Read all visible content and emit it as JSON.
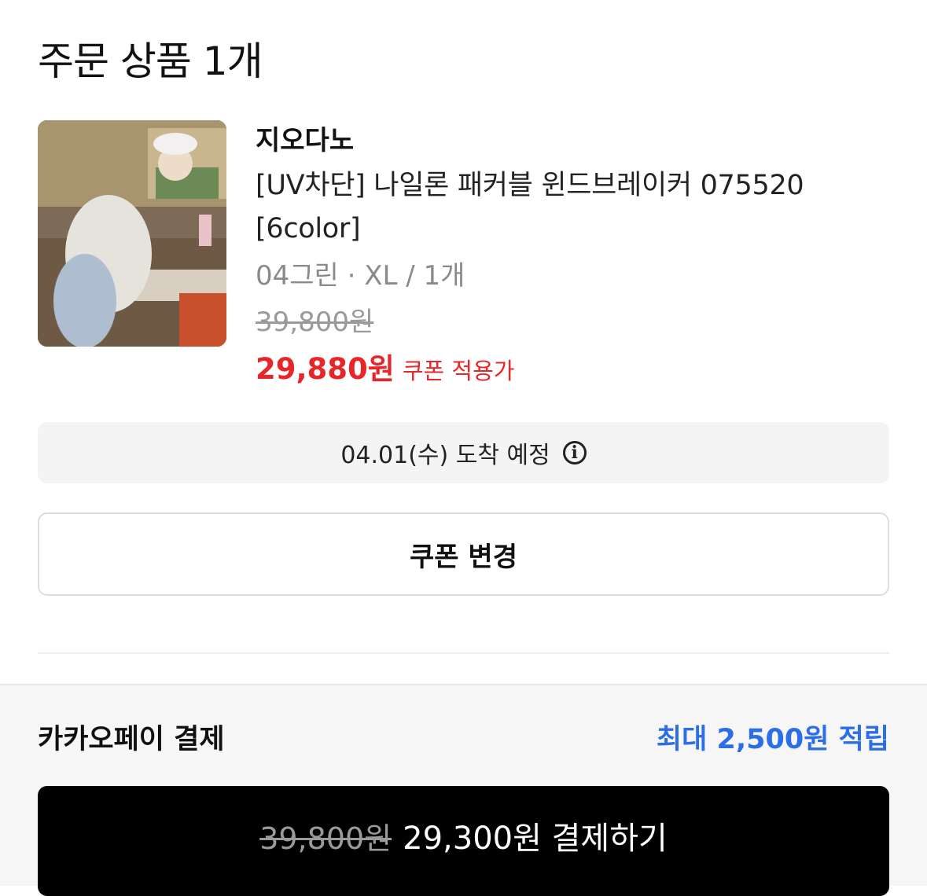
{
  "order": {
    "title": "주문 상품 1개"
  },
  "product": {
    "image_alt": "product photo",
    "brand": "지오다노",
    "name_line1": "[UV차단] 나일론 패커블 윈드브레이커 075520",
    "name_line2": "[6color]",
    "option": "04그린 · XL / 1개",
    "original_price": "39,800원",
    "sale_price": "29,880원",
    "coupon_label": "쿠폰 적용가"
  },
  "delivery": {
    "text": "04.01(수) 도착 예정",
    "icon": "info-icon"
  },
  "coupon_button": {
    "label": "쿠폰 변경"
  },
  "payment": {
    "method_label": "카카오페이 결제",
    "reward_text": "최대 2,500원 적립",
    "button_original_price": "39,800원",
    "button_label": "29,300원 결제하기"
  },
  "colors": {
    "sale_red": "#e8262a",
    "reward_blue": "#2b6ee6",
    "button_black": "#000000"
  }
}
